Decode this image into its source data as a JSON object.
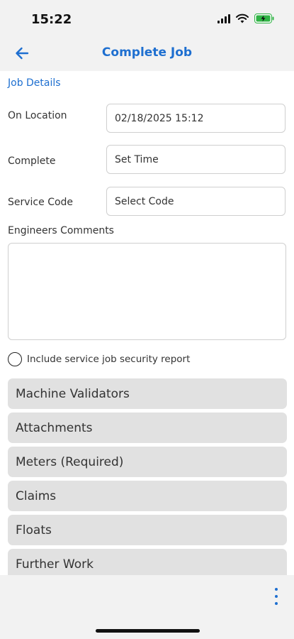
{
  "status_bar": {
    "time": "15:22",
    "icons": [
      "signal-icon",
      "wifi-icon",
      "battery-charging-icon"
    ]
  },
  "header": {
    "title": "Complete Job",
    "back_icon": "arrow-left-icon",
    "accent_color": "#1e6fd0"
  },
  "job_details": {
    "section_title": "Job Details",
    "on_location_label": "On Location",
    "on_location_value": "02/18/2025 15:12",
    "complete_label": "Complete",
    "complete_value": "Set Time",
    "service_code_label": "Service Code",
    "service_code_value": "Select Code",
    "comments_label": "Engineers Comments",
    "comments_value": "",
    "security_report_label": "Include service job security report",
    "security_report_checked": false
  },
  "sections": [
    {
      "label": "Machine Validators"
    },
    {
      "label": "Attachments"
    },
    {
      "label": "Meters (Required)"
    },
    {
      "label": "Claims"
    },
    {
      "label": "Floats"
    },
    {
      "label": "Further Work"
    }
  ],
  "bottom_bar": {
    "more_icon": "more-vertical-icon"
  }
}
